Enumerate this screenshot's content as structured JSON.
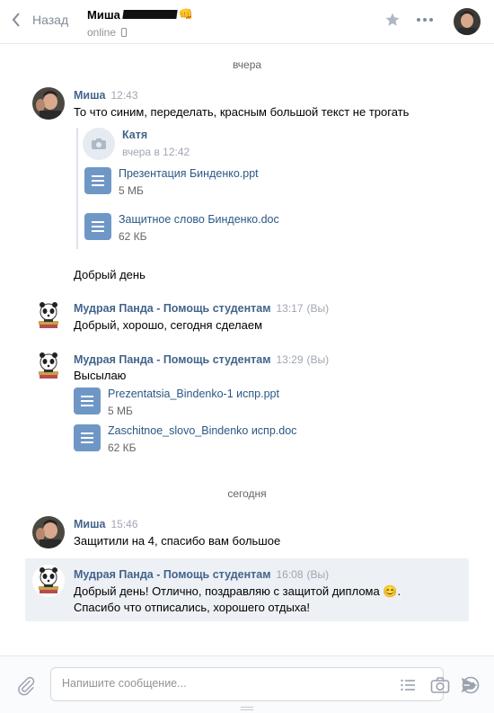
{
  "header": {
    "back_label": "Назад",
    "peer_name": "Миша",
    "peer_status": "online",
    "emoji": "👊"
  },
  "date_separators": {
    "yesterday": "вчера",
    "today": "сегодня"
  },
  "messages": [
    {
      "author": "Миша",
      "time": "12:43",
      "lines": [
        "То что синим, переделать, красным большой текст не трогать"
      ],
      "forwarded": {
        "author": "Катя",
        "time": "вчера в 12:42",
        "docs": [
          {
            "name": "Презентация Бинденко.ppt",
            "size": "5 МБ"
          },
          {
            "name": "Защитное слово Бинденко.doc",
            "size": "62 КБ"
          }
        ]
      },
      "extra_line": "Добрый день"
    },
    {
      "author": "Мудрая Панда - Помощь студентам",
      "time": "13:17",
      "you": "(Вы)",
      "lines": [
        "Добрый, хорошо, сегодня сделаем"
      ]
    },
    {
      "author": "Мудрая Панда - Помощь студентам",
      "time": "13:29",
      "you": "(Вы)",
      "lines": [
        "Высылаю"
      ],
      "docs": [
        {
          "name": "Prezentatsia_Bindenko-1 испр.ppt",
          "size": "5 МБ"
        },
        {
          "name": "Zaschitnoe_slovo_Bindenko испр.doc",
          "size": "62 КБ"
        }
      ]
    },
    {
      "author": "Миша",
      "time": "15:46",
      "lines": [
        "Защитили на 4, спасибо вам большое"
      ]
    },
    {
      "author": "Мудрая Панда - Помощь студентам",
      "time": "16:08",
      "you": "(Вы)",
      "lines": [
        "Добрый день! Отлично, поздравляю с защитой диплома 😊.",
        "Спасибо что отписались, хорошего отдыха!"
      ]
    }
  ],
  "composer": {
    "placeholder": "Напишите сообщение..."
  },
  "colors": {
    "link": "#2a5885",
    "author": "#42648b",
    "doc_icon": "#6f97c6",
    "highlight": "#edf0f5"
  }
}
